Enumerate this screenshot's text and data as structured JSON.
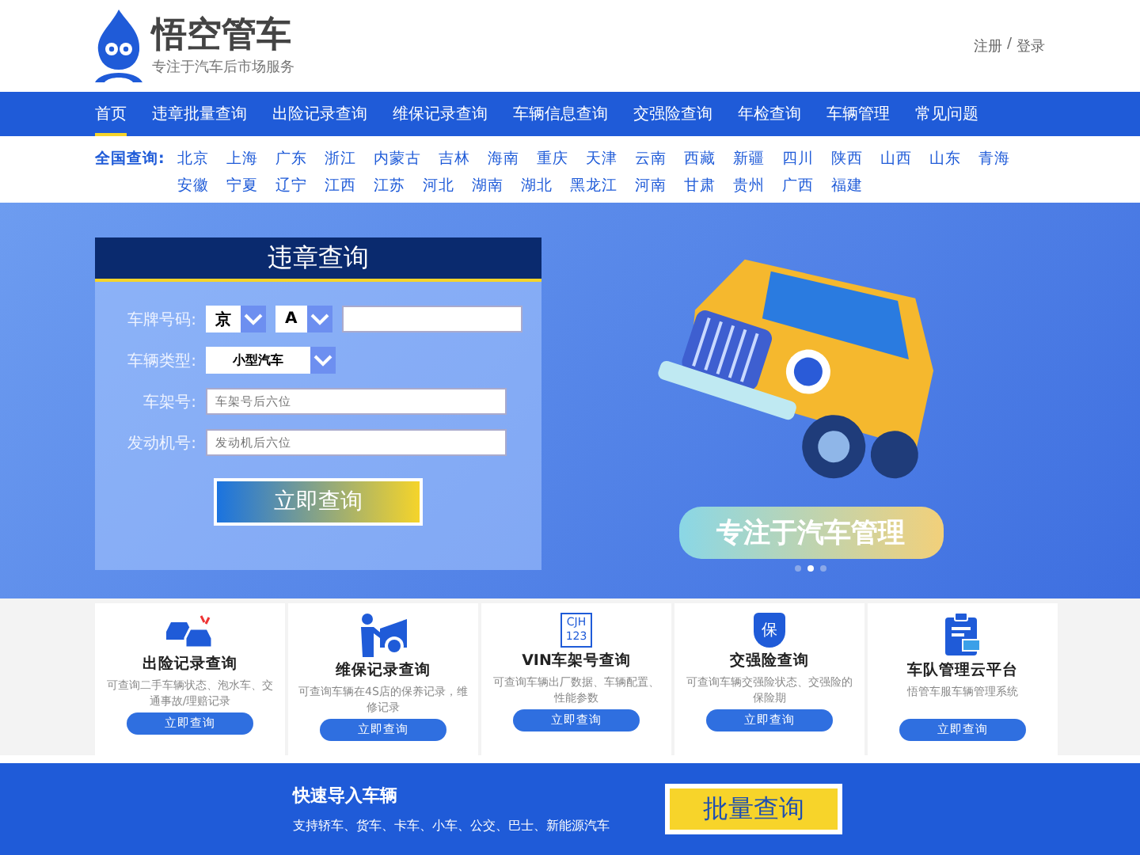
{
  "logo": {
    "name": "悟空管车",
    "tagline": "专注于汽车后市场服务"
  },
  "account": {
    "register": "注册",
    "separator": "/",
    "login": "登录"
  },
  "nav": [
    {
      "label": "首页",
      "selected": true
    },
    {
      "label": "违章批量查询",
      "selected": false
    },
    {
      "label": "出险记录查询",
      "selected": false
    },
    {
      "label": "维保记录查询",
      "selected": false
    },
    {
      "label": "车辆信息查询",
      "selected": false
    },
    {
      "label": "交强险查询",
      "selected": false
    },
    {
      "label": "年检查询",
      "selected": false
    },
    {
      "label": "车辆管理",
      "selected": false
    },
    {
      "label": "常见问题",
      "selected": false
    }
  ],
  "cities": {
    "label": "全国查询:",
    "items": [
      "北京",
      "上海",
      "广东",
      "浙江",
      "内蒙古",
      "吉林",
      "海南",
      "重庆",
      "天津",
      "云南",
      "西藏",
      "新疆",
      "四川",
      "陕西",
      "山西",
      "山东",
      "青海",
      "安徽",
      "宁夏",
      "辽宁",
      "江西",
      "江苏",
      "河北",
      "湖南",
      "湖北",
      "黑龙江",
      "河南",
      "甘肃",
      "贵州",
      "广西",
      "福建"
    ]
  },
  "form": {
    "title": "违章查询",
    "plate_label": "车牌号码:",
    "province": "京",
    "letter": "A",
    "type_label": "车辆类型:",
    "type_value": "小型汽车",
    "frame_label": "车架号:",
    "frame_placeholder": "车架号后六位",
    "engine_label": "发动机号:",
    "engine_placeholder": "发动机后六位",
    "submit": "立即查询"
  },
  "banner": {
    "slogan": "专注于汽车管理",
    "slides": [
      {
        "selected": false
      },
      {
        "selected": true
      },
      {
        "selected": false
      }
    ]
  },
  "services": [
    {
      "kind": "insurance-record",
      "title": "出险记录查询",
      "desc": "可查询二手车辆状态、泡水车、交通事故/理赔记录",
      "button": "立即查询"
    },
    {
      "kind": "maintenance",
      "title": "维保记录查询",
      "desc": "可查询车辆在4S店的保养记录，维修记录",
      "button": "立即查询"
    },
    {
      "kind": "vin",
      "title": "VIN车架号查询",
      "desc": "可查询车辆出厂数据、车辆配置、性能参数",
      "button": "立即查询",
      "icon_text": "CJH 123"
    },
    {
      "kind": "compulsory",
      "title": "交强险查询",
      "desc": "可查询车辆交强险状态、交强险的保险期",
      "button": "立即查询",
      "icon_text": "保"
    },
    {
      "kind": "fleet",
      "title": "车队管理云平台",
      "desc": "悟管车服车辆管理系统",
      "button": "立即查询"
    }
  ],
  "import_bar": {
    "title": "快速导入车辆",
    "desc": "支持轿车、货车、卡车、小车、公交、巴士、新能源汽车",
    "button": "批量查询"
  }
}
